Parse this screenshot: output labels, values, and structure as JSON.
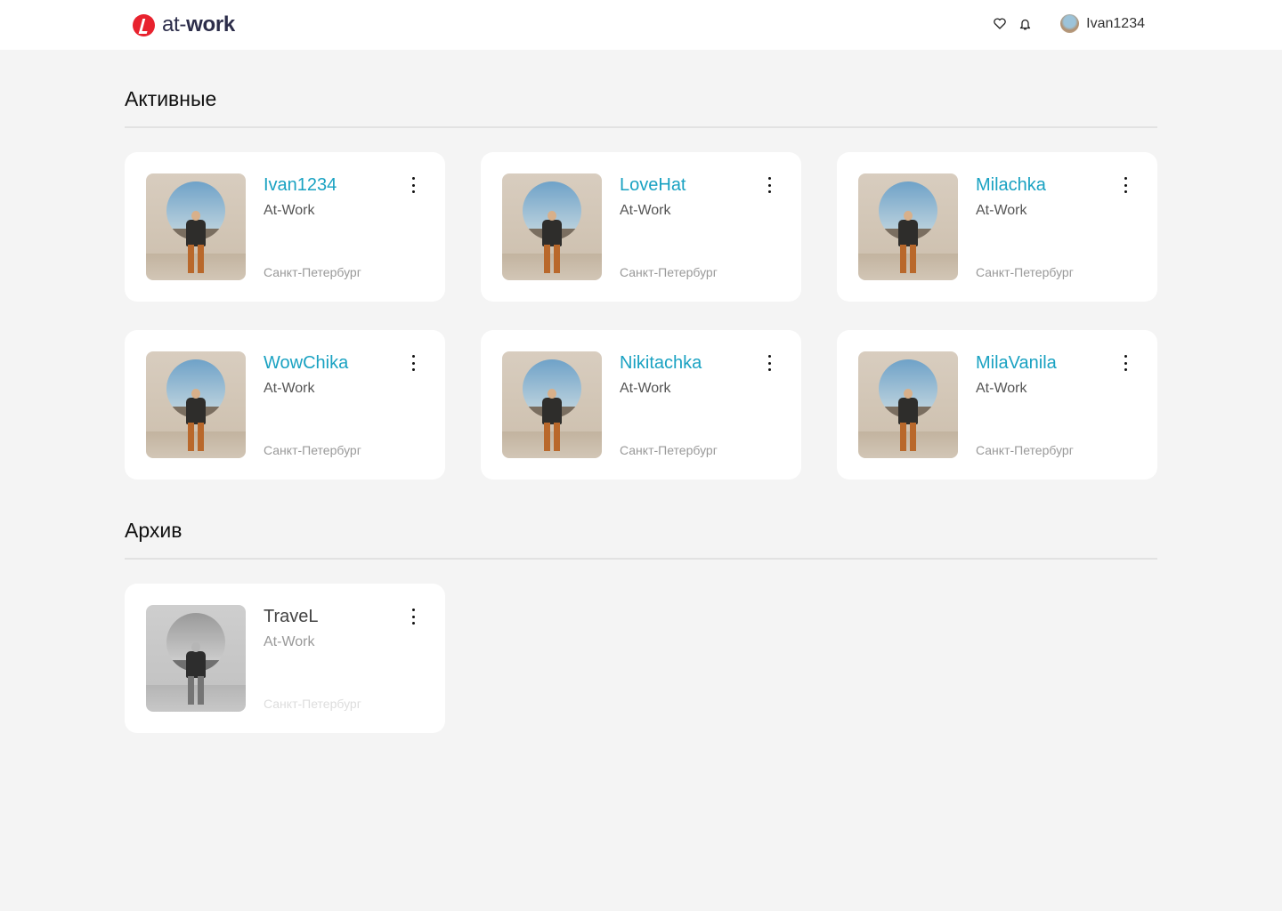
{
  "header": {
    "logo_light": "at-",
    "logo_bold": "work",
    "username": "Ivan1234",
    "icons": [
      "heart-icon",
      "bell-icon"
    ]
  },
  "active": {
    "title": "Активные",
    "cards": [
      {
        "name": "Ivan1234",
        "company": "At-Work",
        "city": "Санкт-Петербург"
      },
      {
        "name": "LoveHat",
        "company": "At-Work",
        "city": "Санкт-Петербург"
      },
      {
        "name": "Milachka",
        "company": "At-Work",
        "city": "Санкт-Петербург"
      },
      {
        "name": "WowChika",
        "company": "At-Work",
        "city": "Санкт-Петербург"
      },
      {
        "name": "Nikitachka",
        "company": "At-Work",
        "city": "Санкт-Петербург"
      },
      {
        "name": "MilaVanila",
        "company": "At-Work",
        "city": "Санкт-Петербург"
      }
    ]
  },
  "archive": {
    "title": "Архив",
    "cards": [
      {
        "name": "TraveL",
        "company": "At-Work",
        "city": "Санкт-Петербург"
      }
    ]
  },
  "colors": {
    "accent": "#1aa2c2",
    "brand": "#e8222e"
  }
}
